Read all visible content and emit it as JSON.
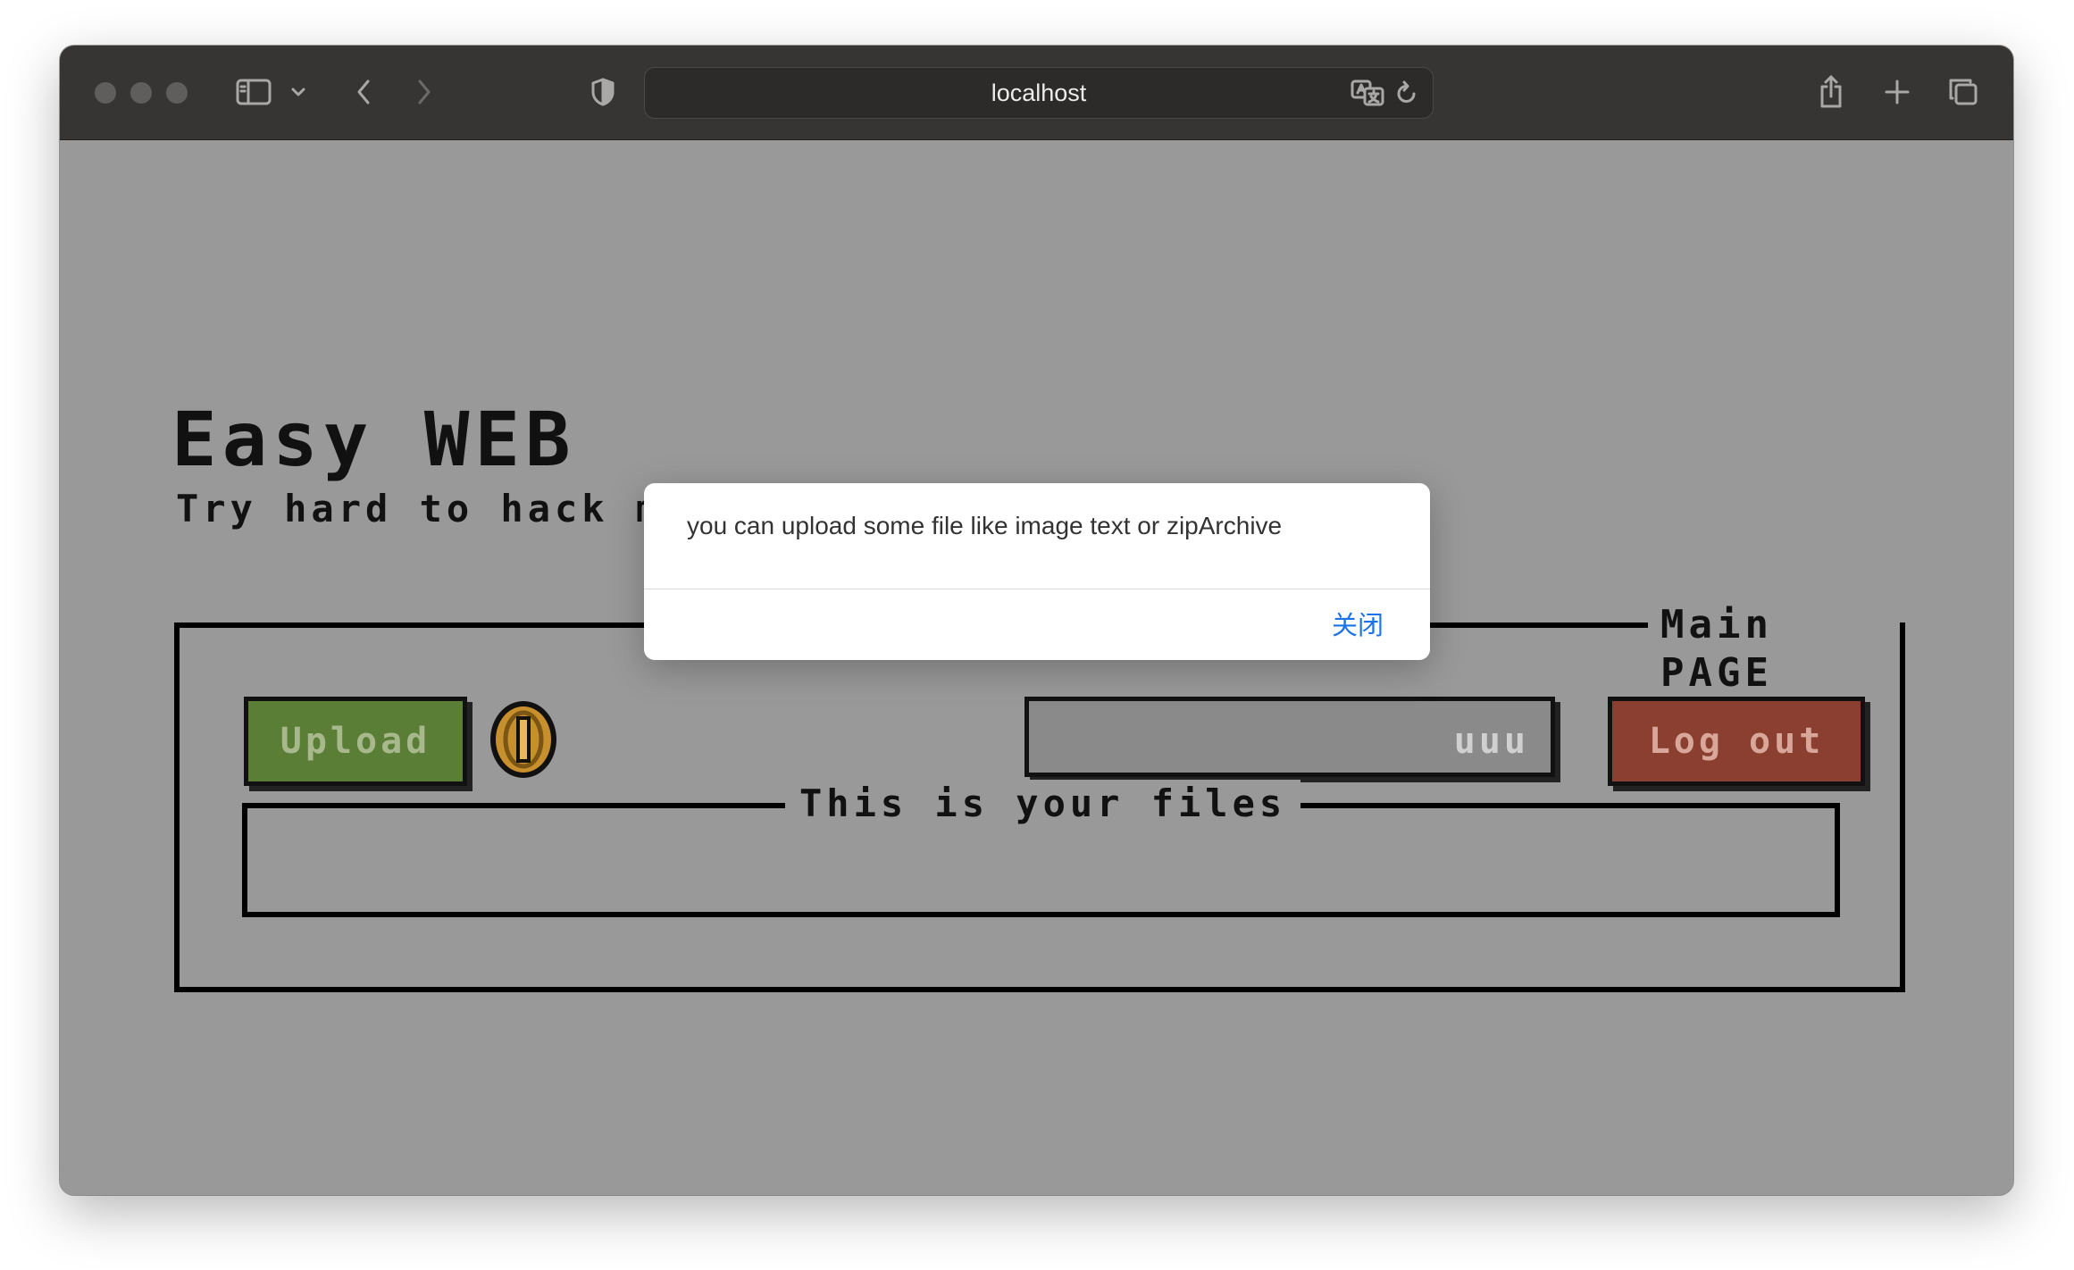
{
  "browser": {
    "url": "localhost",
    "icons": [
      "sidebar-icon",
      "chevron-down-icon",
      "back-icon",
      "forward-icon",
      "shield-icon",
      "translate-icon",
      "reload-icon",
      "share-icon",
      "new-tab-icon",
      "tabs-overview-icon"
    ]
  },
  "page": {
    "title": "Easy WEB",
    "subtitle": "Try hard to hack me",
    "main_legend": "Main PAGE",
    "upload_label": "Upload",
    "middle_button_partial": "uuu",
    "logout_label": "Log out",
    "files_legend": "This is your files",
    "files": []
  },
  "alert": {
    "message": "you can upload some file like image text or zipArchive",
    "close_label": "关闭"
  },
  "colors": {
    "page_bg": "#999999",
    "upload": "#5b7e37",
    "logout": "#8a3f30",
    "coin": "#c8902c",
    "link": "#1a73e8"
  }
}
